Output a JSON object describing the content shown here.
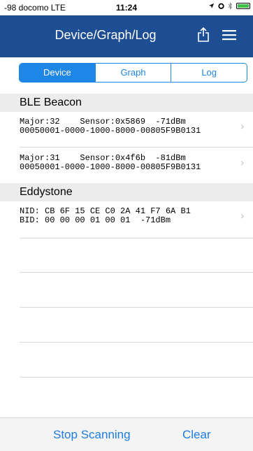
{
  "status_bar": {
    "carrier": "-98 docomo  LTE",
    "time": "11:24"
  },
  "nav": {
    "title": "Device/Graph/Log"
  },
  "segments": [
    "Device",
    "Graph",
    "Log"
  ],
  "selected_segment": "Device",
  "sections": [
    {
      "title": "BLE Beacon",
      "rows": [
        {
          "line1": "Major:32    Sensor:0x5869  -71dBm",
          "line2": "00050001-0000-1000-8000-00805F9B0131"
        },
        {
          "line1": "Major:31    Sensor:0x4f6b  -81dBm",
          "line2": "00050001-0000-1000-8000-00805F9B0131"
        }
      ]
    },
    {
      "title": "Eddystone",
      "rows": [
        {
          "line1": "NID: CB 6F 15 CE C0 2A 41 F7 6A B1",
          "line2": "BID: 00 00 00 01 00 01  -71dBm"
        }
      ]
    }
  ],
  "toolbar": {
    "stop_label": "Stop Scanning",
    "clear_label": "Clear"
  },
  "colors": {
    "nav_background": "#1d4d93",
    "accent": "#1e86e6",
    "section_background": "#ececec",
    "battery_fill": "#3dbf4a"
  },
  "icons": [
    "location-arrow-icon",
    "alarm-icon",
    "bluetooth-icon",
    "battery-icon",
    "share-icon",
    "menu-icon",
    "chevron-right-icon"
  ]
}
